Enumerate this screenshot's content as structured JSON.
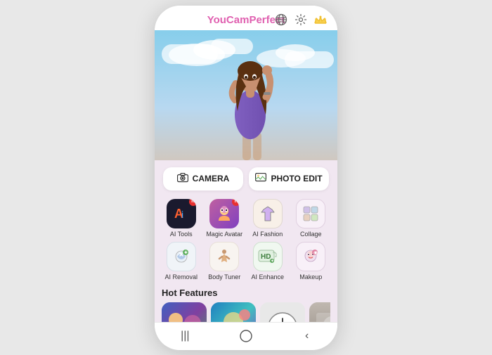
{
  "header": {
    "logo_you_cam": "YouCam",
    "logo_perfect": "Perfect",
    "icons": [
      "globe-icon",
      "settings-icon",
      "crown-icon"
    ]
  },
  "action_buttons": [
    {
      "id": "camera-btn",
      "label": "CAMERA",
      "icon": "📷"
    },
    {
      "id": "photo-edit-btn",
      "label": "PHOTO EDIT",
      "icon": "🖼"
    }
  ],
  "tools": [
    {
      "id": "ai-tools",
      "label": "AI Tools",
      "icon": "🤖",
      "badge": "N",
      "style": "ai-tools"
    },
    {
      "id": "magic-avatar",
      "label": "Magic Avatar",
      "icon": "✨",
      "badge": "N",
      "style": "magic-avatar"
    },
    {
      "id": "ai-fashion",
      "label": "AI Fashion",
      "icon": "👗",
      "style": "ai-fashion"
    },
    {
      "id": "collage",
      "label": "Collage",
      "icon": "⊞",
      "style": "collage"
    },
    {
      "id": "ai-removal",
      "label": "AI Removal",
      "icon": "✦",
      "style": "ai-removal"
    },
    {
      "id": "body-tuner",
      "label": "Body Tuner",
      "icon": "🧍",
      "style": "body-tuner"
    },
    {
      "id": "ai-enhance",
      "label": "AI Enhance",
      "icon": "HD",
      "style": "ai-enhance",
      "text_icon": "HD"
    },
    {
      "id": "makeup",
      "label": "Makeup",
      "icon": "💄",
      "style": "makeup"
    }
  ],
  "hot_features": {
    "title": "Hot Features",
    "items": [
      {
        "id": "hf1",
        "style": "hf-card-1"
      },
      {
        "id": "hf2",
        "style": "hf-card-2"
      },
      {
        "id": "hf3",
        "style": "hf-card-3",
        "clock": true
      },
      {
        "id": "hf4",
        "style": "hf-card-4"
      },
      {
        "id": "hf5",
        "style": "hf-card-5"
      }
    ]
  },
  "nav": {
    "items": [
      "|||",
      "○",
      "‹"
    ]
  }
}
